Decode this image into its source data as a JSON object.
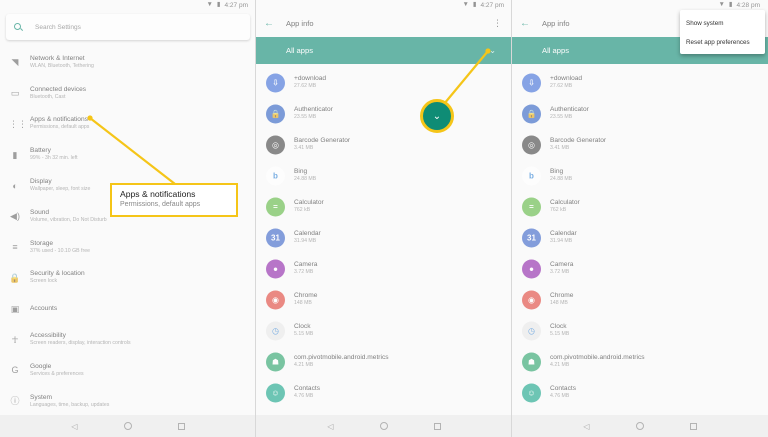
{
  "status": {
    "time1": "4:27 pm",
    "time2": "4:27 pm",
    "time3": "4:28 pm",
    "wifi_icon": "wifi-icon",
    "battery_icon": "battery-icon"
  },
  "settings": {
    "search_placeholder": "Search Settings",
    "items": [
      {
        "icon": "wifi-icon",
        "glyph": "◥",
        "title": "Network & Internet",
        "subtitle": "WLAN, Bluetooth, Tethering"
      },
      {
        "icon": "devices-icon",
        "glyph": "▭",
        "title": "Connected devices",
        "subtitle": "Bluetooth, Cast"
      },
      {
        "icon": "apps-grid-icon",
        "glyph": "⋮⋮",
        "title": "Apps & notifications",
        "subtitle": "Permissions, default apps"
      },
      {
        "icon": "battery-icon",
        "glyph": "▮",
        "title": "Battery",
        "subtitle": "99% - 3h 32 min. left"
      },
      {
        "icon": "display-icon",
        "glyph": "◐",
        "title": "Display",
        "subtitle": "Wallpaper, sleep, font size"
      },
      {
        "icon": "sound-icon",
        "glyph": "◀)",
        "title": "Sound",
        "subtitle": "Volume, vibration, Do Not Disturb"
      },
      {
        "icon": "storage-icon",
        "glyph": "≡",
        "title": "Storage",
        "subtitle": "37% used - 10.10 GB free"
      },
      {
        "icon": "lock-icon",
        "glyph": "🔒",
        "title": "Security & location",
        "subtitle": "Screen lock"
      },
      {
        "icon": "account-icon",
        "glyph": "▣",
        "title": "Accounts",
        "subtitle": ""
      },
      {
        "icon": "accessibility-icon",
        "glyph": "☥",
        "title": "Accessibility",
        "subtitle": "Screen readers, display, interaction controls"
      },
      {
        "icon": "google-icon",
        "glyph": "G",
        "title": "Google",
        "subtitle": "Services & preferences"
      },
      {
        "icon": "info-icon",
        "glyph": "ⓘ",
        "title": "System",
        "subtitle": "Languages, time, backup, updates"
      }
    ]
  },
  "appinfo": {
    "title": "App info",
    "filter_label": "All apps",
    "apps": [
      {
        "name": "+download",
        "size": "27.62 MB",
        "icon": "download-app-icon",
        "color": "#3f6fd8",
        "glyph": "⇩"
      },
      {
        "name": "Authenticator",
        "size": "23.55 MB",
        "icon": "authenticator-app-icon",
        "color": "#2f62c4",
        "glyph": "🔒"
      },
      {
        "name": "Barcode Generator",
        "size": "3.41 MB",
        "icon": "barcode-app-icon",
        "color": "#444444",
        "glyph": "◎"
      },
      {
        "name": "Bing",
        "size": "24.88 MB",
        "icon": "bing-app-icon",
        "color": "#ffffff",
        "glyph": "b"
      },
      {
        "name": "Calculator",
        "size": "762 kB",
        "icon": "calculator-app-icon",
        "color": "#5fb843",
        "glyph": "="
      },
      {
        "name": "Calendar",
        "size": "31.94 MB",
        "icon": "calendar-app-icon",
        "color": "#3a64c8",
        "glyph": "31"
      },
      {
        "name": "Camera",
        "size": "3.72 MB",
        "icon": "camera-app-icon",
        "color": "#8e24aa",
        "glyph": "●"
      },
      {
        "name": "Chrome",
        "size": "148 MB",
        "icon": "chrome-app-icon",
        "color": "#e0453a",
        "glyph": "◉"
      },
      {
        "name": "Clock",
        "size": "5.15 MB",
        "icon": "clock-app-icon",
        "color": "#e8e8e8",
        "glyph": "◷"
      },
      {
        "name": "com.pivotmobile.android.metrics",
        "size": "4.21 MB",
        "icon": "android-app-icon",
        "color": "#2aa36b",
        "glyph": "☗"
      },
      {
        "name": "Contacts",
        "size": "4.76 MB",
        "icon": "contacts-app-icon",
        "color": "#17a589",
        "glyph": "☺"
      }
    ]
  },
  "menu": {
    "show_system": "Show system",
    "reset": "Reset app preferences"
  },
  "callout": {
    "title": "Apps & notifications",
    "subtitle": "Permissions, default apps"
  },
  "colors": {
    "accent": "#0f8c75",
    "highlight": "#f5c518"
  }
}
